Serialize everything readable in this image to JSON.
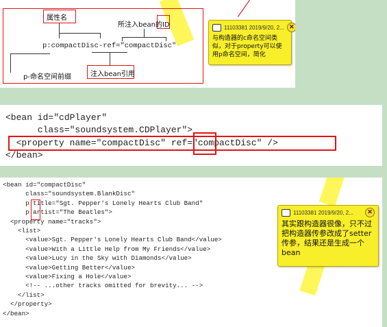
{
  "panel1": {
    "labels": {
      "attr_name": "属性名",
      "bean_id": "所注入bean的ID",
      "prefix": "p-命名空间前缀",
      "bean_ref": "注入bean引用"
    },
    "code": "p:compactDisc-ref=\"compactDisc\"",
    "comment": {
      "header": "11103381 2019/9/20, 2...",
      "text": "与构造器的c命名空间类似，对于property可以使用p命名空间，简化"
    }
  },
  "panel2": {
    "lines": [
      "<bean id=\"cdPlayer\"",
      "      class=\"soundsystem.CDPlayer\">",
      "  <property name=\"compactDisc\" ref=\"compactDisc\" />",
      "</bean>"
    ]
  },
  "panel3": {
    "lines": [
      "<bean id=\"compactDisc\"",
      "      class=\"soundsystem.BlankDisc\"",
      "      p:title=\"Sgt. Pepper's Lonely Hearts Club Band\"",
      "      p:artist=\"The Beatles\">",
      "  <property name=\"tracks\">",
      "    <list>",
      "      <value>Sgt. Pepper's Lonely Hearts Club Band</value>",
      "      <value>With a Little Help from My Friends</value>",
      "      <value>Lucy in the Sky with Diamonds</value>",
      "      <value>Getting Better</value>",
      "      <value>Fixing a Hole</value>",
      "      <!-- ...other tracks omitted for brevity... -->",
      "    </list>",
      "  </property>",
      "</bean>"
    ],
    "comment": {
      "header": "11103381 2019/9/20, 2...",
      "text": "其实跟构造器很像，只不过把构造器传参改成了setter传参，结果还是生成一个bean"
    }
  },
  "colors": {
    "background": "#c5dfc4",
    "highlight_red": "#e01414",
    "comment_yellow": "#f8ee2a"
  }
}
